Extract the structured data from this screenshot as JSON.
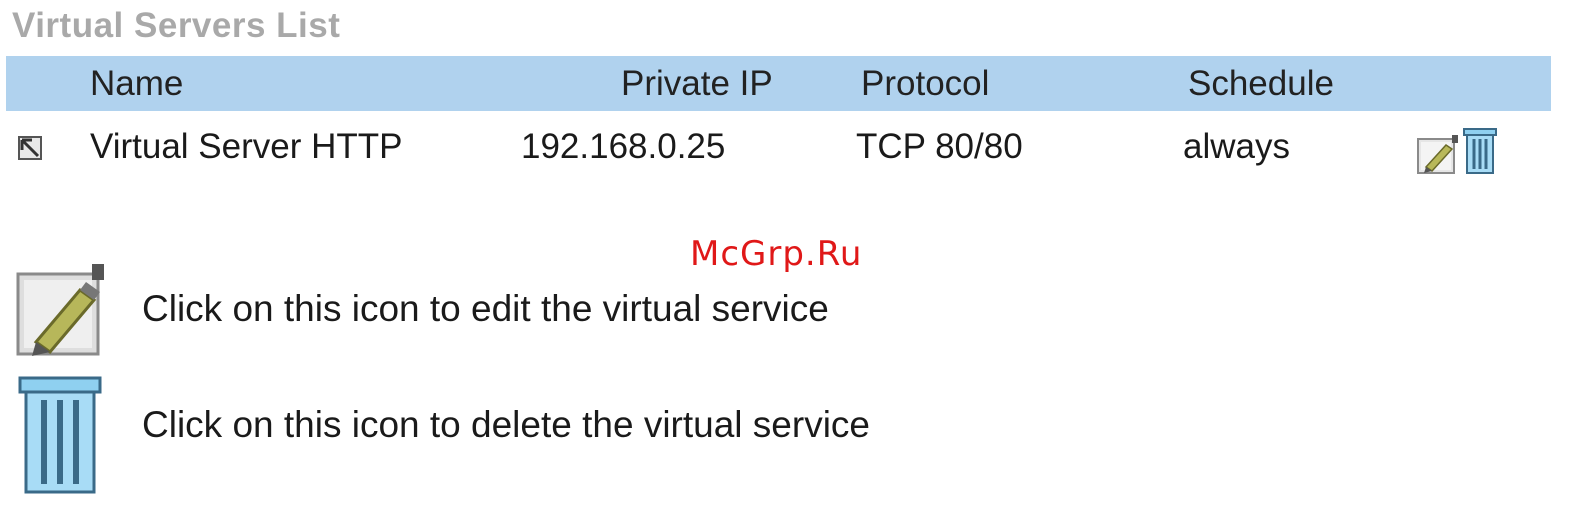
{
  "section": {
    "title": "Virtual Servers List"
  },
  "table": {
    "headers": {
      "name": "Name",
      "private_ip": "Private IP",
      "protocol": "Protocol",
      "schedule": "Schedule"
    },
    "rows": [
      {
        "name": "Virtual Server HTTP",
        "private_ip": "192.168.0.25",
        "protocol": "TCP 80/80",
        "schedule": "always",
        "checked": true
      }
    ]
  },
  "watermark": "McGrp.Ru",
  "legend": {
    "edit_text": "Click on this icon to edit the virtual service",
    "delete_text": "Click on this icon to delete the virtual service"
  },
  "icons": {
    "edit": "edit-icon",
    "delete": "trash-icon"
  },
  "colors": {
    "header_bg": "#b0d2ee",
    "title": "#a9a9a9",
    "watermark": "#e01818"
  }
}
